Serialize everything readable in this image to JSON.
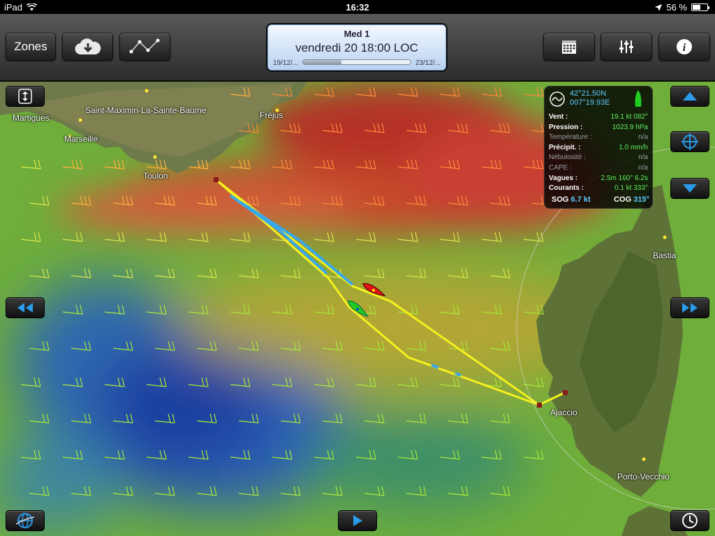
{
  "status_bar": {
    "device": "iPad",
    "time": "16:32",
    "battery": "56 %",
    "battery_level": 0.56
  },
  "toolbar": {
    "zones_label": "Zones",
    "icons": {
      "download": "cloud-download-icon",
      "route": "route-polyline-icon",
      "calendar": "calendar-icon",
      "settings": "sliders-icon",
      "info": "info-icon"
    }
  },
  "time_selector": {
    "title": "Med 1",
    "datetime": "vendredi 20 18:00 LOC",
    "range_start": "19/12/...",
    "range_end": "23/12/...",
    "progress": 0.36
  },
  "map": {
    "labels": [
      {
        "text": "Martigues"
      },
      {
        "text": "Saint-Maximin-La-Sainte-Baume"
      },
      {
        "text": "Fréjus"
      },
      {
        "text": "Marseille"
      },
      {
        "text": "Toulon"
      },
      {
        "text": "Bastia"
      },
      {
        "text": "Ajaccio"
      },
      {
        "text": "Porto-Vecchio"
      }
    ]
  },
  "info_panel": {
    "lat": "42°21.50N",
    "lon": "007°19.93E",
    "rows": [
      {
        "key": "Vent :",
        "value": "19.1 kt 082°",
        "dim": false
      },
      {
        "key": "Pression :",
        "value": "1023.9 hPa",
        "dim": false
      },
      {
        "key": "Température :",
        "value": "n/a",
        "dim": true
      },
      {
        "key": "Précipit. :",
        "value": "1.0 mm/h",
        "dim": false
      },
      {
        "key": "Nébulosité :",
        "value": "n/a",
        "dim": true
      },
      {
        "key": "CAPE :",
        "value": "n/a",
        "dim": true
      },
      {
        "key": "Vagues :",
        "value": "2.5m 160° 6.2s",
        "dim": false
      },
      {
        "key": "Courants :",
        "value": "0.1 kt 333°",
        "dim": false
      }
    ],
    "sog_label": "SOG",
    "sog_value": "6.7 kt",
    "cog_label": "COG",
    "cog_value": "315°"
  },
  "colors": {
    "route_yellow": "#f5f01e",
    "route_blue": "#3aa8e8",
    "boat_red": "#e01414",
    "boat_green": "#22cc22",
    "accent_blue": "#2a9bea"
  }
}
